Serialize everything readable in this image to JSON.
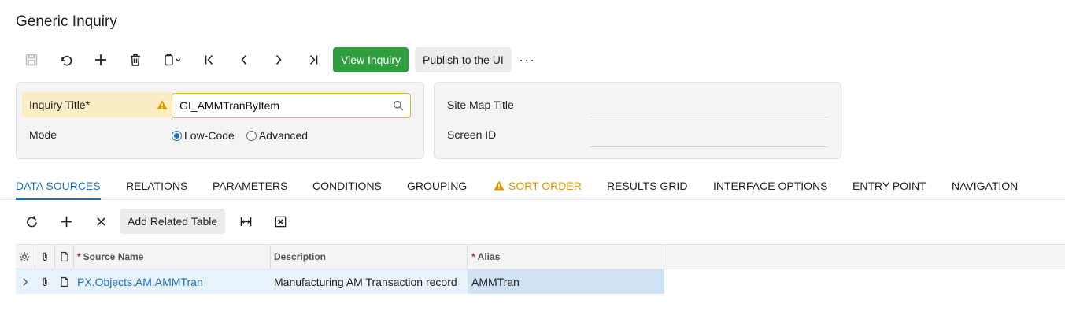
{
  "page": {
    "title": "Generic Inquiry"
  },
  "toolbar": {
    "icons": [
      "save-icon",
      "undo-icon",
      "add-icon",
      "delete-icon",
      "copy-paste-icon",
      "first-icon",
      "prev-icon",
      "next-icon",
      "last-icon"
    ],
    "view_inquiry_label": "View Inquiry",
    "publish_label": "Publish to the UI",
    "more_label": "···"
  },
  "summary": {
    "inquiry_title_label": "Inquiry Title",
    "inquiry_title_required": "*",
    "inquiry_title_value": "GI_AMMTranByItem",
    "mode_label": "Mode",
    "mode_options": [
      "Low-Code",
      "Advanced"
    ],
    "mode_selected": "Low-Code",
    "site_map_title_label": "Site Map Title",
    "site_map_title_value": "",
    "screen_id_label": "Screen ID",
    "screen_id_value": ""
  },
  "tabs": [
    {
      "label": "DATA SOURCES",
      "active": true
    },
    {
      "label": "RELATIONS"
    },
    {
      "label": "PARAMETERS"
    },
    {
      "label": "CONDITIONS"
    },
    {
      "label": "GROUPING"
    },
    {
      "label": "SORT ORDER",
      "warning": true
    },
    {
      "label": "RESULTS GRID"
    },
    {
      "label": "INTERFACE OPTIONS"
    },
    {
      "label": "ENTRY POINT"
    },
    {
      "label": "NAVIGATION"
    }
  ],
  "grid_toolbar": {
    "icons": [
      "refresh-icon",
      "add-row-icon",
      "delete-row-icon",
      "fit-columns-icon",
      "export-excel-icon"
    ],
    "add_related_label": "Add Related Table"
  },
  "grid": {
    "columns": [
      {
        "label": "Source Name",
        "required": true
      },
      {
        "label": "Description",
        "required": false
      },
      {
        "label": "Alias",
        "required": true
      }
    ],
    "required_mark": "*",
    "rows": [
      {
        "source_name": "PX.Objects.AM.AMMTran",
        "description": "Manufacturing AM Transaction record",
        "alias": "AMMTran"
      }
    ]
  },
  "colors": {
    "accent": "#1f72b8",
    "primary_button": "#2e9e3f",
    "warning": "#d59a00",
    "required_highlight": "#fbedc4"
  }
}
